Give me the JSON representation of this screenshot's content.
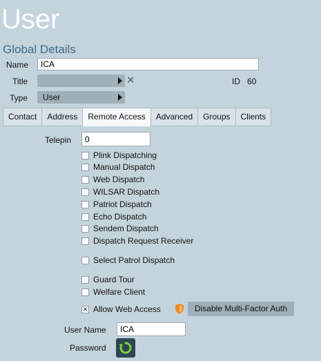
{
  "page": {
    "title": "User"
  },
  "global": {
    "section_title": "Global Details",
    "name_label": "Name",
    "name_value": "ICA",
    "title_label": "Title",
    "title_value": "",
    "id_label": "ID",
    "id_value": "60",
    "type_label": "Type",
    "type_value": "User"
  },
  "tabs": [
    "Contact",
    "Address",
    "Remote Access",
    "Advanced",
    "Groups",
    "Clients"
  ],
  "active_tab": "Remote Access",
  "remote": {
    "telepin_label": "Telepin",
    "telepin_value": "0",
    "checkboxes": [
      {
        "label": "Plink Dispatching",
        "checked": false
      },
      {
        "label": "Manual Dispatch",
        "checked": false
      },
      {
        "label": "Web Dispatch",
        "checked": false
      },
      {
        "label": "WILSAR Dispatch",
        "checked": false
      },
      {
        "label": "Patriot Dispatch",
        "checked": false
      },
      {
        "label": "Echo Dispatch",
        "checked": false
      },
      {
        "label": "Sendem Dispatch",
        "checked": false
      },
      {
        "label": "Dispatch Request Receiver",
        "checked": false
      },
      {
        "label": "Select Patrol Dispatch",
        "checked": false
      },
      {
        "label": "Guard Tour",
        "checked": false
      },
      {
        "label": "Welfare Client",
        "checked": false
      },
      {
        "label": "Allow Web Access",
        "checked": true
      }
    ],
    "mfa_button": "Disable Multi-Factor Auth",
    "username_label": "User Name",
    "username_value": "ICA",
    "password_label": "Password"
  },
  "colors": {
    "background": "#c4d4dd",
    "accent": "#3d6a86",
    "button": "#9fb0b9",
    "shield": "#f08a24"
  }
}
